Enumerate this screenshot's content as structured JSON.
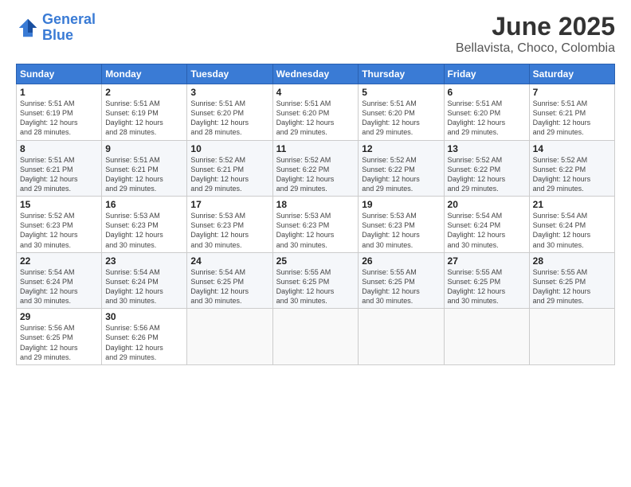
{
  "header": {
    "logo_line1": "General",
    "logo_line2": "Blue",
    "title": "June 2025",
    "subtitle": "Bellavista, Choco, Colombia"
  },
  "weekdays": [
    "Sunday",
    "Monday",
    "Tuesday",
    "Wednesday",
    "Thursday",
    "Friday",
    "Saturday"
  ],
  "weeks": [
    [
      {
        "day": "1",
        "info": "Sunrise: 5:51 AM\nSunset: 6:19 PM\nDaylight: 12 hours\nand 28 minutes."
      },
      {
        "day": "2",
        "info": "Sunrise: 5:51 AM\nSunset: 6:19 PM\nDaylight: 12 hours\nand 28 minutes."
      },
      {
        "day": "3",
        "info": "Sunrise: 5:51 AM\nSunset: 6:20 PM\nDaylight: 12 hours\nand 28 minutes."
      },
      {
        "day": "4",
        "info": "Sunrise: 5:51 AM\nSunset: 6:20 PM\nDaylight: 12 hours\nand 29 minutes."
      },
      {
        "day": "5",
        "info": "Sunrise: 5:51 AM\nSunset: 6:20 PM\nDaylight: 12 hours\nand 29 minutes."
      },
      {
        "day": "6",
        "info": "Sunrise: 5:51 AM\nSunset: 6:20 PM\nDaylight: 12 hours\nand 29 minutes."
      },
      {
        "day": "7",
        "info": "Sunrise: 5:51 AM\nSunset: 6:21 PM\nDaylight: 12 hours\nand 29 minutes."
      }
    ],
    [
      {
        "day": "8",
        "info": "Sunrise: 5:51 AM\nSunset: 6:21 PM\nDaylight: 12 hours\nand 29 minutes."
      },
      {
        "day": "9",
        "info": "Sunrise: 5:51 AM\nSunset: 6:21 PM\nDaylight: 12 hours\nand 29 minutes."
      },
      {
        "day": "10",
        "info": "Sunrise: 5:52 AM\nSunset: 6:21 PM\nDaylight: 12 hours\nand 29 minutes."
      },
      {
        "day": "11",
        "info": "Sunrise: 5:52 AM\nSunset: 6:22 PM\nDaylight: 12 hours\nand 29 minutes."
      },
      {
        "day": "12",
        "info": "Sunrise: 5:52 AM\nSunset: 6:22 PM\nDaylight: 12 hours\nand 29 minutes."
      },
      {
        "day": "13",
        "info": "Sunrise: 5:52 AM\nSunset: 6:22 PM\nDaylight: 12 hours\nand 29 minutes."
      },
      {
        "day": "14",
        "info": "Sunrise: 5:52 AM\nSunset: 6:22 PM\nDaylight: 12 hours\nand 29 minutes."
      }
    ],
    [
      {
        "day": "15",
        "info": "Sunrise: 5:52 AM\nSunset: 6:23 PM\nDaylight: 12 hours\nand 30 minutes."
      },
      {
        "day": "16",
        "info": "Sunrise: 5:53 AM\nSunset: 6:23 PM\nDaylight: 12 hours\nand 30 minutes."
      },
      {
        "day": "17",
        "info": "Sunrise: 5:53 AM\nSunset: 6:23 PM\nDaylight: 12 hours\nand 30 minutes."
      },
      {
        "day": "18",
        "info": "Sunrise: 5:53 AM\nSunset: 6:23 PM\nDaylight: 12 hours\nand 30 minutes."
      },
      {
        "day": "19",
        "info": "Sunrise: 5:53 AM\nSunset: 6:23 PM\nDaylight: 12 hours\nand 30 minutes."
      },
      {
        "day": "20",
        "info": "Sunrise: 5:54 AM\nSunset: 6:24 PM\nDaylight: 12 hours\nand 30 minutes."
      },
      {
        "day": "21",
        "info": "Sunrise: 5:54 AM\nSunset: 6:24 PM\nDaylight: 12 hours\nand 30 minutes."
      }
    ],
    [
      {
        "day": "22",
        "info": "Sunrise: 5:54 AM\nSunset: 6:24 PM\nDaylight: 12 hours\nand 30 minutes."
      },
      {
        "day": "23",
        "info": "Sunrise: 5:54 AM\nSunset: 6:24 PM\nDaylight: 12 hours\nand 30 minutes."
      },
      {
        "day": "24",
        "info": "Sunrise: 5:54 AM\nSunset: 6:25 PM\nDaylight: 12 hours\nand 30 minutes."
      },
      {
        "day": "25",
        "info": "Sunrise: 5:55 AM\nSunset: 6:25 PM\nDaylight: 12 hours\nand 30 minutes."
      },
      {
        "day": "26",
        "info": "Sunrise: 5:55 AM\nSunset: 6:25 PM\nDaylight: 12 hours\nand 30 minutes."
      },
      {
        "day": "27",
        "info": "Sunrise: 5:55 AM\nSunset: 6:25 PM\nDaylight: 12 hours\nand 30 minutes."
      },
      {
        "day": "28",
        "info": "Sunrise: 5:55 AM\nSunset: 6:25 PM\nDaylight: 12 hours\nand 29 minutes."
      }
    ],
    [
      {
        "day": "29",
        "info": "Sunrise: 5:56 AM\nSunset: 6:25 PM\nDaylight: 12 hours\nand 29 minutes."
      },
      {
        "day": "30",
        "info": "Sunrise: 5:56 AM\nSunset: 6:26 PM\nDaylight: 12 hours\nand 29 minutes."
      },
      {
        "day": "",
        "info": ""
      },
      {
        "day": "",
        "info": ""
      },
      {
        "day": "",
        "info": ""
      },
      {
        "day": "",
        "info": ""
      },
      {
        "day": "",
        "info": ""
      }
    ]
  ]
}
